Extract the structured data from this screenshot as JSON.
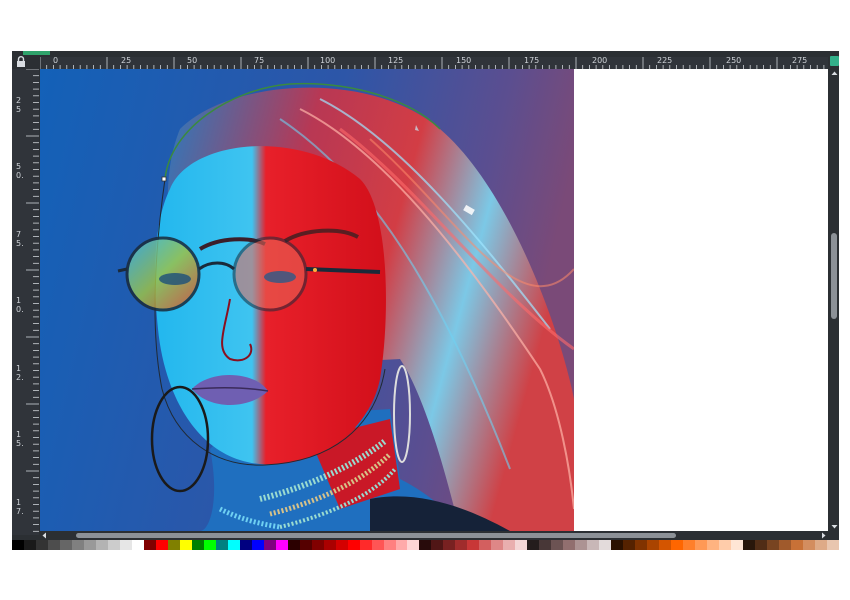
{
  "ruler": {
    "h_labels": [
      "0",
      "25",
      "50",
      "75",
      "100",
      "125",
      "150",
      "175",
      "200",
      "225",
      "250",
      "275"
    ],
    "v_labels": [
      "2",
      "5",
      "5",
      "0.",
      "7",
      "5.",
      "1",
      "0.",
      "1",
      "2.",
      "1",
      "5.",
      "1",
      "7."
    ]
  },
  "icons": {
    "lock": "lock-icon",
    "snap": "snap-icon",
    "scroll_up": "arrow-up-icon",
    "scroll_down": "arrow-down-icon",
    "scroll_left": "arrow-left-icon",
    "scroll_right": "arrow-right-icon"
  },
  "colors": {
    "chrome": "#2b2f33",
    "accent": "#2fa36b",
    "canvas": "#ffffff"
  },
  "palette": [
    "#000000",
    "#1a1a1a",
    "#333333",
    "#4d4d4d",
    "#666666",
    "#808080",
    "#999999",
    "#b3b3b3",
    "#cccccc",
    "#e6e6e6",
    "#ffffff",
    "#800000",
    "#ff0000",
    "#808000",
    "#ffff00",
    "#008000",
    "#00ff00",
    "#008080",
    "#00ffff",
    "#000080",
    "#0000ff",
    "#800080",
    "#ff00ff",
    "#2b0000",
    "#550000",
    "#800000",
    "#aa0000",
    "#d40000",
    "#ff0000",
    "#ff2a2a",
    "#ff5555",
    "#ff8080",
    "#ffaaaa",
    "#ffd5d5",
    "#280b0b",
    "#501616",
    "#782121",
    "#a02c2c",
    "#c83737",
    "#d35f5f",
    "#de8787",
    "#e9afaf",
    "#f4d7d7",
    "#241c1c",
    "#483737",
    "#6c5353",
    "#916f6f",
    "#ac9393",
    "#c8b7b7",
    "#e3dbdb",
    "#2b1100",
    "#552200",
    "#803300",
    "#aa4400",
    "#d45500",
    "#ff6600",
    "#ff7f2a",
    "#ff9955",
    "#ffb380",
    "#ffccaa",
    "#ffe6d5",
    "#28170b",
    "#502d16",
    "#784421",
    "#a05a2c",
    "#c87137",
    "#d38d5f",
    "#deaa87",
    "#e9c6af"
  ]
}
